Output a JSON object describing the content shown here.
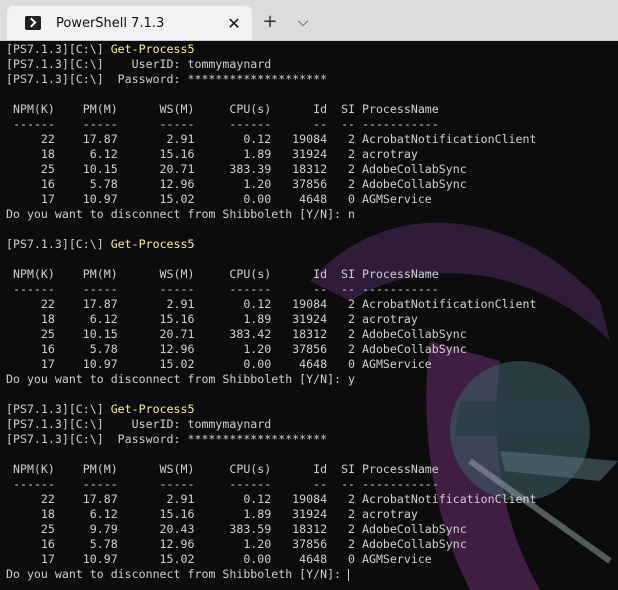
{
  "window": {
    "tab_title": "PowerShell 7.1.3",
    "tab_close": "✕",
    "new_tab": "+",
    "dropdown": "⌵"
  },
  "terminal": {
    "lines": [
      {
        "prompt": "[PS7.1.3][C:\\] ",
        "cmd": "Get-Process5"
      },
      {
        "text": "[PS7.1.3][C:\\]    UserID: tommymaynard"
      },
      {
        "text": "[PS7.1.3][C:\\]  Password: ********************"
      },
      {
        "text": ""
      },
      {
        "text": " NPM(K)    PM(M)      WS(M)     CPU(s)      Id  SI ProcessName"
      },
      {
        "text": " ------    -----      -----     ------      --  -- -----------"
      },
      {
        "text": "     22    17.87       2.91       0.12   19084   2 AcrobatNotificationClient"
      },
      {
        "text": "     18     6.12      15.16       1.89   31924   2 acrotray"
      },
      {
        "text": "     25    10.15      20.71     383.39   18312   2 AdobeCollabSync"
      },
      {
        "text": "     16     5.78      12.96       1.20   37856   2 AdobeCollabSync"
      },
      {
        "text": "     17    10.97      15.02       0.00    4648   0 AGMService"
      },
      {
        "text": "Do you want to disconnect from Shibboleth [Y/N]: n"
      },
      {
        "text": ""
      },
      {
        "prompt": "[PS7.1.3][C:\\] ",
        "cmd": "Get-Process5"
      },
      {
        "text": ""
      },
      {
        "text": " NPM(K)    PM(M)      WS(M)     CPU(s)      Id  SI ProcessName"
      },
      {
        "text": " ------    -----      -----     ------      --  -- -----------"
      },
      {
        "text": "     22    17.87       2.91       0.12   19084   2 AcrobatNotificationClient"
      },
      {
        "text": "     18     6.12      15.16       1.89   31924   2 acrotray"
      },
      {
        "text": "     25    10.15      20.71     383.42   18312   2 AdobeCollabSync"
      },
      {
        "text": "     16     5.78      12.96       1.20   37856   2 AdobeCollabSync"
      },
      {
        "text": "     17    10.97      15.02       0.00    4648   0 AGMService"
      },
      {
        "text": "Do you want to disconnect from Shibboleth [Y/N]: y"
      },
      {
        "text": ""
      },
      {
        "prompt": "[PS7.1.3][C:\\] ",
        "cmd": "Get-Process5"
      },
      {
        "text": "[PS7.1.3][C:\\]    UserID: tommymaynard"
      },
      {
        "text": "[PS7.1.3][C:\\]  Password: ********************"
      },
      {
        "text": ""
      },
      {
        "text": " NPM(K)    PM(M)      WS(M)     CPU(s)      Id  SI ProcessName"
      },
      {
        "text": " ------    -----      -----     ------      --  -- -----------"
      },
      {
        "text": "     22    17.87       2.91       0.12   19084   2 AcrobatNotificationClient"
      },
      {
        "text": "     18     6.12      15.16       1.89   31924   2 acrotray"
      },
      {
        "text": "     25     9.79      20.43     383.59   18312   2 AdobeCollabSync"
      },
      {
        "text": "     16     5.78      12.96       1.20   37856   2 AdobeCollabSync"
      },
      {
        "text": "     17    10.97      15.02       0.00    4648   0 AGMService"
      },
      {
        "text": "Do you want to disconnect from Shibboleth [Y/N]: ",
        "cursor": true
      }
    ]
  },
  "colors": {
    "background": "#0c0c0c",
    "foreground": "#cfcfcf",
    "command": "#f2f28c",
    "watermark_purple": "#6a3a86",
    "watermark_teal": "#3f5c66"
  }
}
